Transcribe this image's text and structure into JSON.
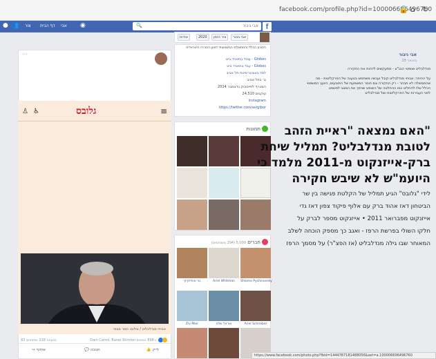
{
  "browser": {
    "url": "facebook.com/profile.php?id=100006696496760",
    "icons": [
      "lock-icon",
      "home-icon",
      "reload-icon"
    ]
  },
  "fb_bar": {
    "logo": "f",
    "search_placeholder": "אבי גיבור",
    "nav": [
      "אבי",
      "דף הבית",
      "צור"
    ],
    "icons": [
      "friends-icon",
      "messages-icon",
      "notifications-icon",
      "help-icon"
    ]
  },
  "profile_header": {
    "name_pill": "אבי גיבור",
    "tabs": [
      "ציר הזמן",
      "2020",
      "אודות"
    ]
  },
  "intro": {
    "bio": "התובע הכללי והממשלתי המשמעותי למען החברה הישראלית",
    "lines": [
      "עובד בתאגיד ביט - Globes",
      "עבד בתאגיד ביט - Globes",
      "למד באוניברסיטת תל אביב",
      "גר בתל אביב",
      "הצטרף לפייסבוק בדצמבר 2014",
      "עוקבים 24,510",
      "instagram",
      "https://twitter.com/avigibor"
    ]
  },
  "photos": {
    "title": "תמונות",
    "color": "#42b72a"
  },
  "friends": {
    "title": "חברים",
    "count": "5,000 (294 משותפים)",
    "names": [
      "Shlomo Pyshinovsky",
      "Ariel Whitman",
      "גבי אוחיזקיקי",
      "Ariel Schreiber",
      "אוראל שלם",
      "Ziv Meir"
    ]
  },
  "post": {
    "author": "אבי גיבור",
    "meta": "28 בינואר",
    "text": [
      "מנדלבליט ושופטי הבג\"צ - מתעקשים לדחות את החקירה",
      "על ההיתר: אביחי מנדלבליט קיבל ועכשיו משתמש בטענה של הפרקליטות - מה",
      "שהממשלה לא תבחר - רק החקירה וגם חוסר המשמעת של התובעים, היועץ המשפטי",
      "הכלל שלו להחליט כמו ההחלטה של השופט שהפך את המצב למשפט",
      "לפני העבירות של הפרקליטות ושל מנדלבליט"
    ],
    "more_dots": "···"
  },
  "article": {
    "logo": "גלובס",
    "headline": [
      "האם נמצאה \"ראיית הזהב\"",
      "לטובת מנדלבליט? תמליל שיחת",
      "ברק-אייזנקוט מ-2011 מלמד כי",
      "היועמ\"ש לא שיבש חקירה"
    ],
    "lead": [
      "לידי \"גלובס\" הגיע תמליל של הקלטת פגישה בין שר",
      "הביטחון דאז אהוד ברק עם אלוף פיקוד צפון דאז גדי",
      "אייזנקוט מפברואר 2011 • אייזנקוט מספר לברק על",
      "חלקו השולי בפרשת הרפז - ואגב כך מספק הוכחה לשלב",
      "המאוחר שבו גילה מנדלבליט (אז הפצ\"ר) על מסמך הרפז"
    ],
    "caption": "אביחי מנדלבליט / צילום: תמר מצפי"
  },
  "reactions": {
    "left": "83 תגובות 118 שיתופים",
    "right": "Dani Carmi, Baraz Shimon ו-898 נוספים"
  },
  "actions": {
    "like": "לייק",
    "comment": "תגובה",
    "share": "שיתוף"
  },
  "status_bar": "https://www.facebook.com/photo.php?fbid=1444787181488056&set=a.100006696496760"
}
